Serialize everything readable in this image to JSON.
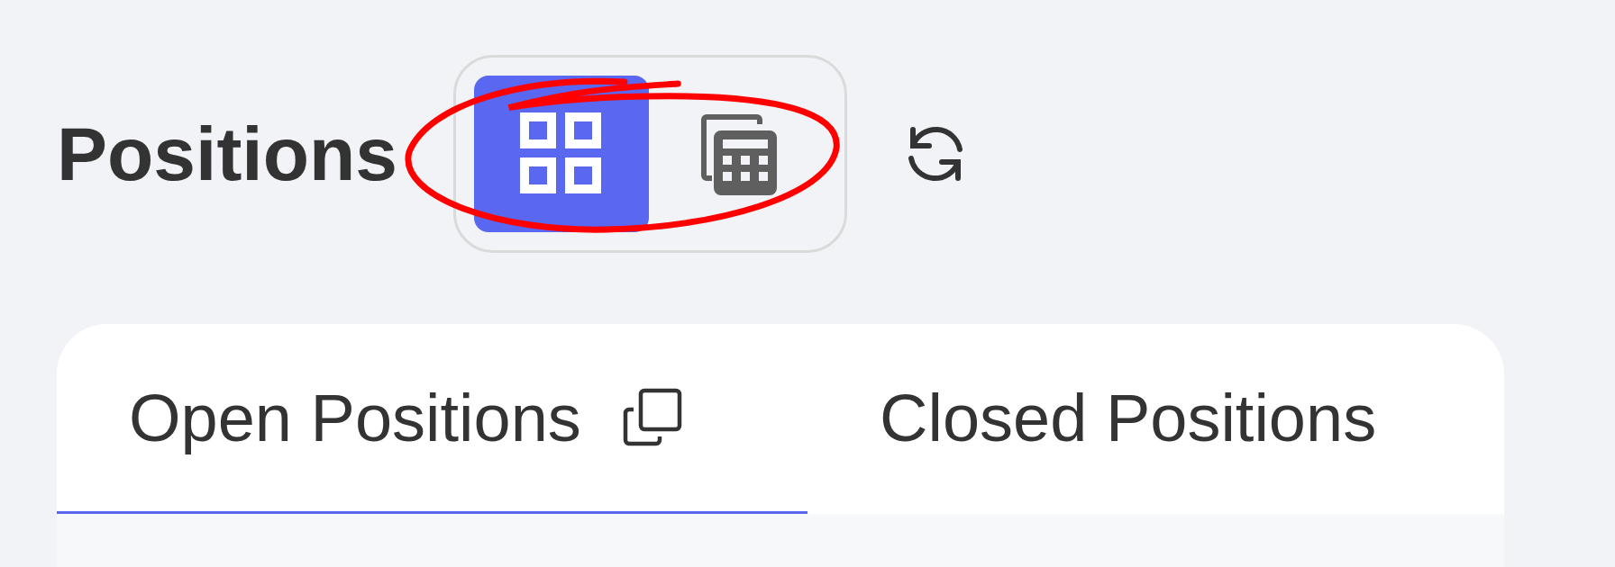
{
  "title": "Positions",
  "view_toggle": [
    {
      "kind": "grid",
      "selected": true
    },
    {
      "kind": "calculator",
      "selected": false
    }
  ],
  "tabs": [
    {
      "label": "Open Positions",
      "selected": true,
      "has_copy_icon": true
    },
    {
      "label": "Closed Positions",
      "selected": false,
      "has_copy_icon": false
    }
  ]
}
